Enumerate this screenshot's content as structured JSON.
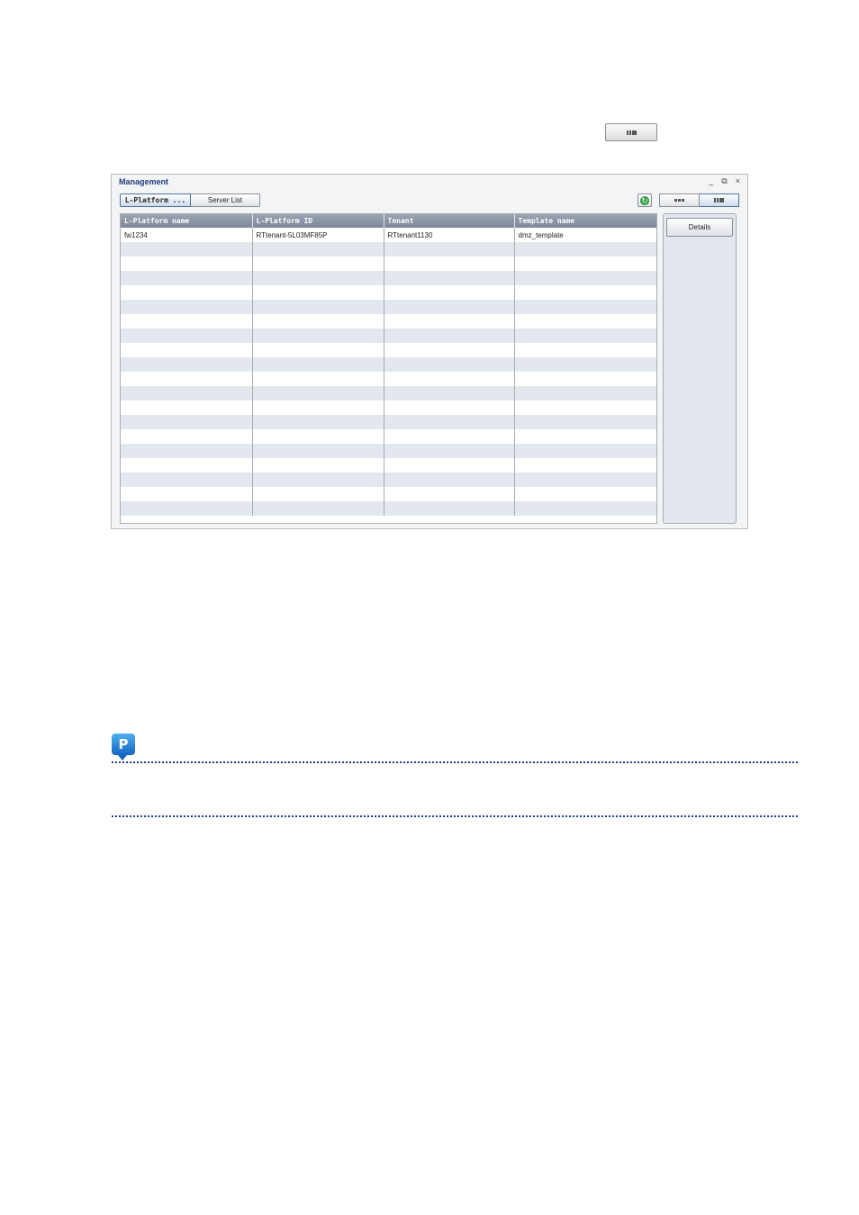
{
  "icons": {
    "top_inline": "list-view-icon",
    "refresh": "refresh-icon",
    "point": "point-icon"
  },
  "panel": {
    "title": "Management",
    "controls": {
      "minimize": "_",
      "restore": "⧉",
      "close": "×"
    },
    "tabs": [
      {
        "label": "L-Platform ...",
        "active": true
      },
      {
        "label": "Server List",
        "active": false
      }
    ],
    "view_switch": [
      "icon-view",
      "list-view"
    ],
    "table": {
      "columns": [
        "L-Platform name",
        "L-Platform ID",
        "Tenant",
        "Template name"
      ],
      "rows": [
        [
          "fw1234",
          "RTtenant-5L03MF85P",
          "RTtenant1130",
          "dmz_template"
        ]
      ]
    },
    "side": {
      "details_label": "Details"
    }
  },
  "colors": {
    "title": "#1e3a78",
    "header": "#8a93a3",
    "stripe": "#e3e8ef",
    "point_icon": "#1e7ad6",
    "dotted_rule": "#1d3f8f"
  }
}
